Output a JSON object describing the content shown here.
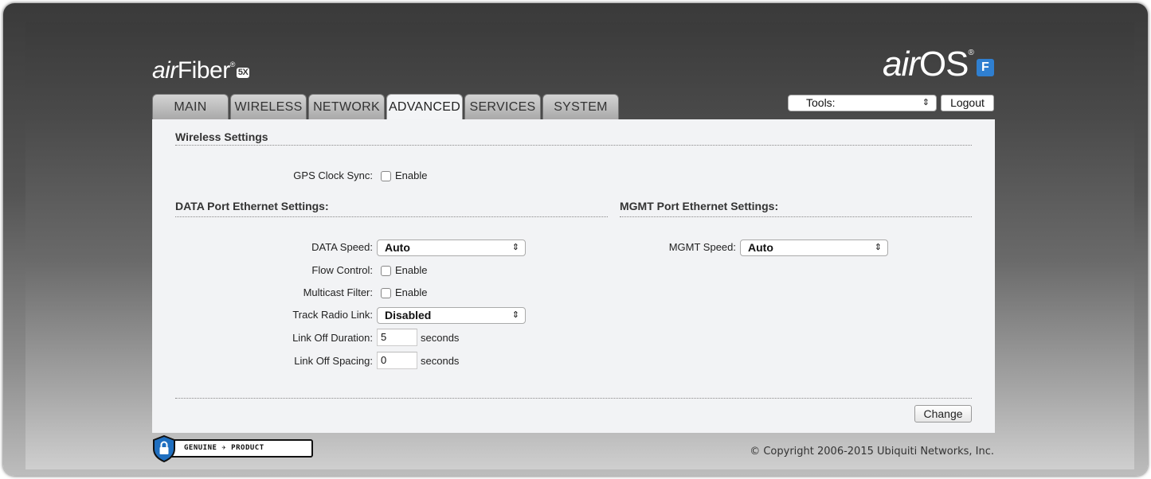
{
  "branding": {
    "left_prefix": "air",
    "left_name": "Fiber",
    "left_badge": "5X",
    "right_prefix": "air",
    "right_name": "OS",
    "right_badge": "F"
  },
  "tabs": [
    {
      "label": "MAIN",
      "active": false
    },
    {
      "label": "WIRELESS",
      "active": false
    },
    {
      "label": "NETWORK",
      "active": false
    },
    {
      "label": "ADVANCED",
      "active": true
    },
    {
      "label": "SERVICES",
      "active": false
    },
    {
      "label": "SYSTEM",
      "active": false
    }
  ],
  "header": {
    "tools_value": "Tools:",
    "logout_label": "Logout"
  },
  "wireless": {
    "title": "Wireless Settings",
    "gps_label": "GPS Clock Sync:",
    "gps_checkbox_text": "Enable",
    "gps_checked": false
  },
  "data_port": {
    "title": "DATA Port Ethernet Settings:",
    "speed_label": "DATA Speed:",
    "speed_value": "Auto",
    "flow_label": "Flow Control:",
    "flow_text": "Enable",
    "flow_checked": false,
    "multicast_label": "Multicast Filter:",
    "multicast_text": "Enable",
    "multicast_checked": false,
    "track_label": "Track Radio Link:",
    "track_value": "Disabled",
    "off_duration_label": "Link Off Duration:",
    "off_duration_value": "5",
    "off_duration_unit": "seconds",
    "off_spacing_label": "Link Off Spacing:",
    "off_spacing_value": "0",
    "off_spacing_unit": "seconds"
  },
  "mgmt_port": {
    "title": "MGMT Port Ethernet Settings:",
    "speed_label": "MGMT Speed:",
    "speed_value": "Auto"
  },
  "footer": {
    "change_label": "Change",
    "genuine_text": "GENUINE ✈ PRODUCT",
    "copyright": "© Copyright 2006-2015 Ubiquiti Networks, Inc."
  },
  "colors": {
    "panel_bg": "#f2f3f5",
    "brand_badge": "#2f7fd0",
    "tab_bg": "#b5b5b5"
  }
}
